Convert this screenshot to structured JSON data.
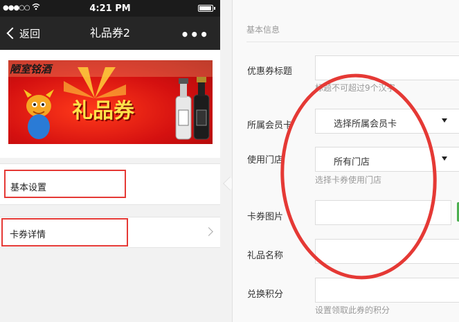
{
  "status_bar": {
    "signal": "●●●○○",
    "time": "4:21 PM"
  },
  "nav_bar": {
    "back_label": "返回",
    "title": "礼品券2",
    "more_label": "•••"
  },
  "banner": {
    "brand_text": "陋室铭酒",
    "title_text": "礼品券"
  },
  "menu": {
    "basic_settings": "基本设置",
    "coupon_details": "卡券详情"
  },
  "form": {
    "section_title": "基本信息",
    "coupon_title": {
      "label": "优惠券标题",
      "value": "",
      "hint": "标题不可超过9个汉字"
    },
    "member_card": {
      "label": "所属会员卡",
      "selected": "选择所属会员卡"
    },
    "store": {
      "label": "使用门店",
      "selected": "所有门店",
      "hint": "选择卡券使用门店"
    },
    "coupon_image": {
      "label": "卡券图片"
    },
    "gift_name": {
      "label": "礼品名称",
      "value": ""
    },
    "points": {
      "label": "兑换积分",
      "value": "",
      "hint": "设置领取此券的积分"
    }
  },
  "colors": {
    "annotation": "#e53935",
    "nav_bg": "#262626",
    "status_bg": "#1b1b1b",
    "upload_green": "#4caf50"
  }
}
